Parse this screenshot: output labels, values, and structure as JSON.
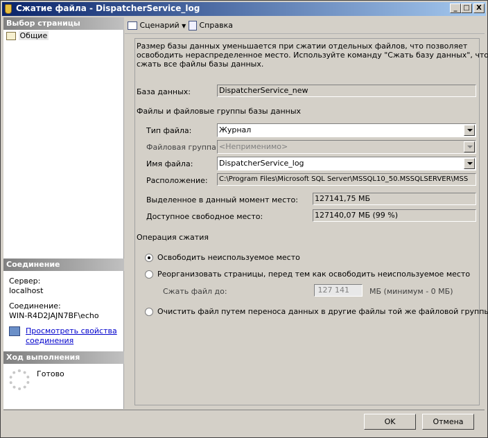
{
  "window": {
    "title": "Сжатие файла - DispatcherService_log",
    "minimize": "_",
    "maximize": "□",
    "close": "X"
  },
  "left": {
    "select_page_header": "Выбор страницы",
    "pages": [
      {
        "label": "Общие"
      }
    ],
    "connection_header": "Соединение",
    "server_label": "Сервер:",
    "server_value": "localhost",
    "connection_label": "Соединение:",
    "connection_value": "WIN-R4D2JAJN7BF\\echo",
    "view_props_link_1": "Просмотреть свойства",
    "view_props_link_2": "соединения",
    "progress_header": "Ход выполнения",
    "progress_status": "Готово"
  },
  "toolbar": {
    "script_label": "Сценарий",
    "help_label": "Справка"
  },
  "main": {
    "description_1": "Размер базы данных уменьшается при сжатии отдельных файлов, что позволяет",
    "description_2": "освободить нераспределенное место. Используйте команду \"Сжать базу данных\", чтобы",
    "description_3": "сжать все файлы базы данных.",
    "database_label": "База данных:",
    "database_value": "DispatcherService_new",
    "files_group_label": "Файлы и файловые группы базы данных",
    "file_type_label": "Тип файла:",
    "file_type_value": "Журнал",
    "filegroup_label": "Файловая группа:",
    "filegroup_value": "<Неприменимо>",
    "file_name_label": "Имя файла:",
    "file_name_value": "DispatcherService_log",
    "location_label": "Расположение:",
    "location_value": "C:\\Program Files\\Microsoft SQL Server\\MSSQL10_50.MSSQLSERVER\\MSS",
    "allocated_label": "Выделенное в данный момент место:",
    "allocated_value": "127141,75 МБ",
    "free_label": "Доступное свободное место:",
    "free_value": "127140,07 МБ (99 %)",
    "shrink_op_label": "Операция сжатия",
    "opt_release": "Освободить неиспользуемое место",
    "opt_reorganize": "Реорганизовать страницы, перед тем как освободить неиспользуемое место",
    "shrink_to_label": "Сжать файл до:",
    "shrink_to_value": "127 141",
    "shrink_unit": "МБ (минимум - 0 МБ)",
    "opt_empty": "Очистить файл путем переноса данных в другие файлы той же файловой группы"
  },
  "buttons": {
    "ok": "OK",
    "cancel": "Отмена"
  }
}
